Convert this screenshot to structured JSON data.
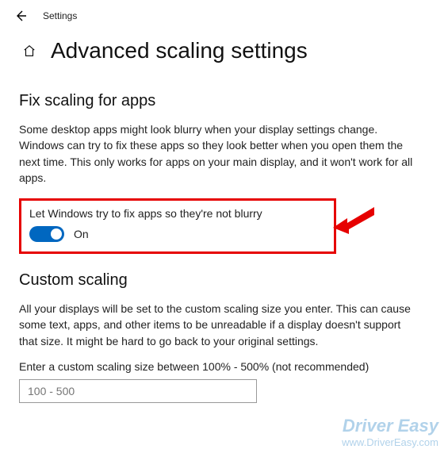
{
  "topbar": {
    "settings_label": "Settings"
  },
  "header": {
    "page_title": "Advanced scaling settings"
  },
  "section_fix": {
    "title": "Fix scaling for apps",
    "description": "Some desktop apps might look blurry when your display settings change. Windows can try to fix these apps so they look better when you open them the next time. This only works for apps on your main display, and it won't work for all apps.",
    "toggle_label": "Let Windows try to fix apps so they're not blurry",
    "toggle_state": "On"
  },
  "section_custom": {
    "title": "Custom scaling",
    "description": "All your displays will be set to the custom scaling size you enter. This can cause some text, apps, and other items to be unreadable if a display doesn't support that size. It might be hard to go back to your original settings.",
    "input_label": "Enter a custom scaling size between 100% - 500% (not recommended)",
    "input_placeholder": "100 - 500"
  },
  "watermark": {
    "line1": "Driver Easy",
    "line2": "www.DriverEasy.com"
  },
  "highlight_color": "#e60000",
  "accent_color": "#0067c0"
}
